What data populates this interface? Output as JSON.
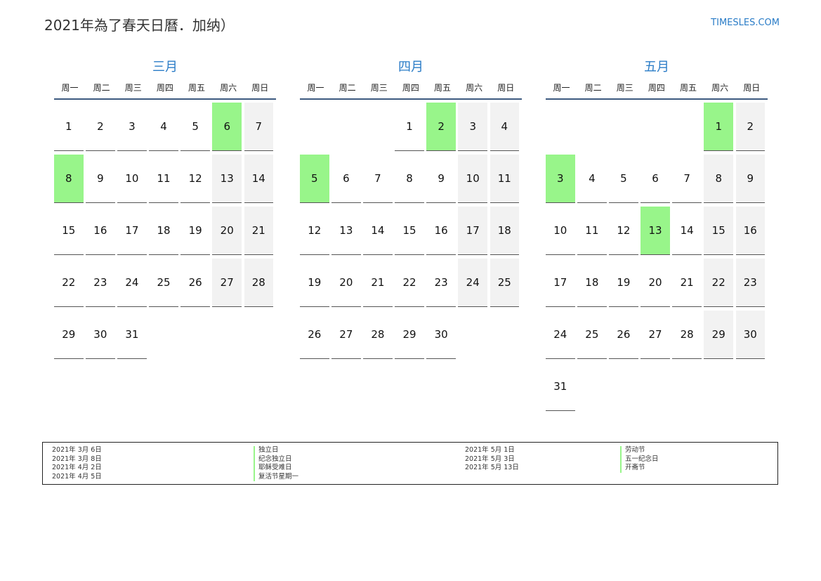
{
  "page": {
    "title": "2021年為了春天日曆．加纳）",
    "site": "TIMESLES.COM"
  },
  "weekdays": [
    "周一",
    "周二",
    "周三",
    "周四",
    "周五",
    "周六",
    "周日"
  ],
  "months": [
    {
      "name": "三月",
      "offset": 0,
      "days": 31,
      "holidays": [
        6,
        8
      ]
    },
    {
      "name": "四月",
      "offset": 3,
      "days": 30,
      "holidays": [
        2,
        5
      ]
    },
    {
      "name": "五月",
      "offset": 5,
      "days": 31,
      "holidays": [
        1,
        3,
        13
      ]
    }
  ],
  "legend": {
    "group1": [
      {
        "date": "2021年 3月 6日",
        "name": "独立日"
      },
      {
        "date": "2021年 3月 8日",
        "name": "纪念独立日"
      },
      {
        "date": "2021年 4月 2日",
        "name": "耶稣受难日"
      },
      {
        "date": "2021年 4月 5日",
        "name": "复活节星期一"
      }
    ],
    "group2": [
      {
        "date": "2021年 5月 1日",
        "name": "劳动节"
      },
      {
        "date": "2021年 5月 3日",
        "name": "五一纪念日"
      },
      {
        "date": "2021年 5月 13日",
        "name": "开斋节"
      }
    ]
  },
  "colors": {
    "accent": "#2a7cc7",
    "holiday": "#98f58a",
    "weekend": "#f2f2f2",
    "rule": "#3d5a80"
  }
}
